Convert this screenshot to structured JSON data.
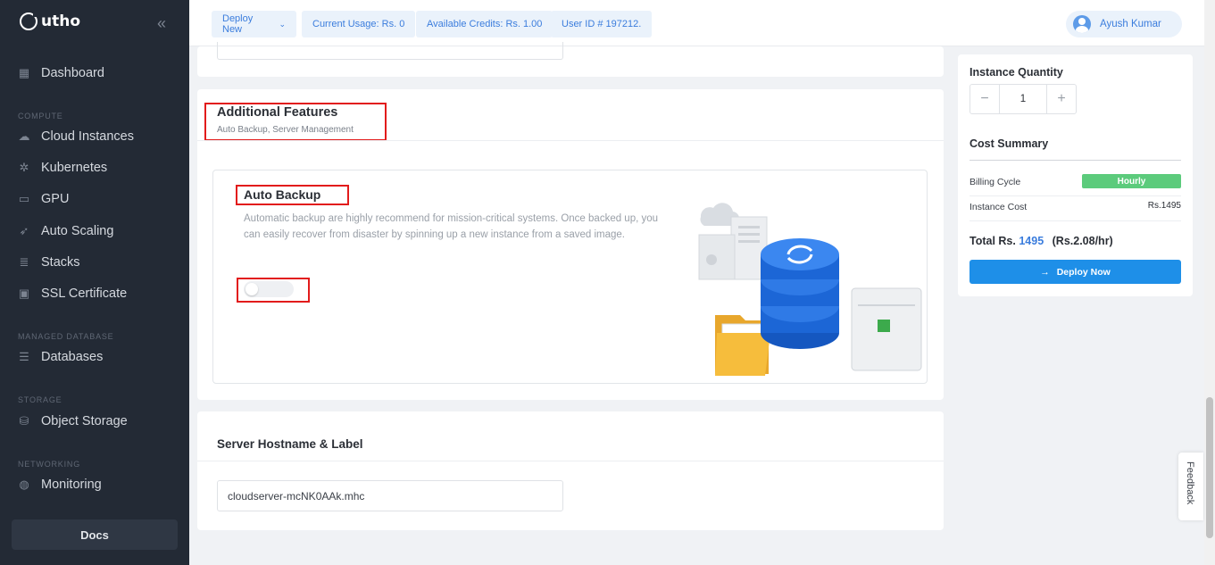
{
  "app": {
    "brand": "utho"
  },
  "sidebar": {
    "collapse_icon": "double-chevron-left-icon",
    "items": [
      {
        "label": "Dashboard",
        "icon": "grid-icon"
      },
      {
        "section": "COMPUTE"
      },
      {
        "label": "Cloud Instances",
        "icon": "cloud-icon"
      },
      {
        "label": "Kubernetes",
        "icon": "kubernetes-icon"
      },
      {
        "label": "GPU",
        "icon": "gpu-icon"
      },
      {
        "label": "Auto Scaling",
        "icon": "rocket-icon"
      },
      {
        "label": "Stacks",
        "icon": "stack-icon"
      },
      {
        "label": "SSL Certificate",
        "icon": "lock-icon"
      },
      {
        "section": "MANAGED DATABASE"
      },
      {
        "label": "Databases",
        "icon": "database-icon"
      },
      {
        "section": "STORAGE"
      },
      {
        "label": "Object Storage",
        "icon": "bucket-icon"
      },
      {
        "section": "NETWORKING"
      },
      {
        "label": "Monitoring",
        "icon": "globe-icon"
      }
    ],
    "docs_label": "Docs"
  },
  "topbar": {
    "deploy_new": "Deploy New",
    "current_usage": "Current Usage: Rs. 0",
    "available_credits": "Available Credits: Rs. 1.00",
    "user_id": "User ID # 197212.",
    "user_name": "Ayush Kumar"
  },
  "additional_features": {
    "title": "Additional Features",
    "subtitle": "Auto Backup, Server Management",
    "auto_backup": {
      "title": "Auto Backup",
      "description": "Automatic backup are highly recommend for mission-critical systems. Once backed up, you can easily recover from disaster by spinning up a new instance from a saved image.",
      "enabled": false
    }
  },
  "hostname": {
    "title": "Server Hostname & Label",
    "value": "cloudserver-mcNK0AAk.mhc"
  },
  "summary": {
    "quantity_label": "Instance Quantity",
    "quantity": "1",
    "minus": "−",
    "plus": "+",
    "cost_summary_label": "Cost Summary",
    "billing_cycle_label": "Billing Cycle",
    "billing_cycle_value": "Hourly",
    "instance_cost_label": "Instance Cost",
    "instance_cost_value": "Rs.1495",
    "total_prefix": "Total Rs.",
    "total_amount": "1495",
    "total_hourly": "(Rs.2.08/hr)",
    "deploy_label": "Deploy Now"
  },
  "feedback_label": "Feedback",
  "colors": {
    "sidebar_bg": "#232a35",
    "accent": "#3b7ddd",
    "deploy_button": "#1e8fe8",
    "hourly_badge": "#5ccb7c",
    "annotation_box": "#e21b1b"
  }
}
